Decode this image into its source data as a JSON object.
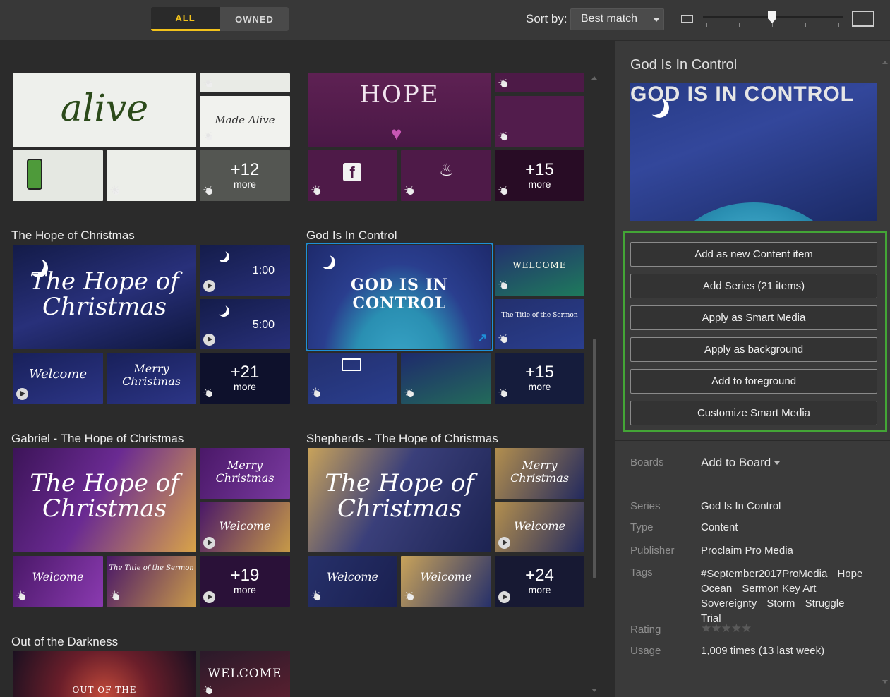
{
  "filters": {
    "all": "ALL",
    "owned": "OWNED"
  },
  "sort": {
    "label": "Sort by:",
    "value": "Best match"
  },
  "groups": {
    "alive": {
      "title": ""
    },
    "hope": {
      "title": ""
    },
    "hope_christmas": {
      "title": "The Hope of Christmas",
      "times": [
        "1:00",
        "5:00"
      ],
      "more": {
        "count": "+21",
        "word": "more"
      }
    },
    "god_control": {
      "title": "God Is In Control",
      "more": {
        "count": "+15",
        "word": "more"
      }
    },
    "gabriel": {
      "title": "Gabriel - The Hope of Christmas",
      "more": {
        "count": "+19",
        "word": "more"
      }
    },
    "shepherds": {
      "title": "Shepherds - The Hope of Christmas",
      "more": {
        "count": "+24",
        "word": "more"
      }
    },
    "darkness": {
      "title": "Out of the Darkness"
    }
  },
  "top_more": {
    "alive": {
      "count": "+12",
      "word": "more"
    },
    "hope": {
      "count": "+15",
      "word": "more"
    }
  },
  "panel": {
    "title": "God Is In Control",
    "actions": [
      "Add as new Content item",
      "Add Series (21 items)",
      "Apply as Smart Media",
      "Apply as background",
      "Add to foreground",
      "Customize Smart Media"
    ],
    "boards_label": "Boards",
    "add_board": "Add to Board",
    "meta": {
      "series_label": "Series",
      "series": "God Is In Control",
      "type_label": "Type",
      "type": "Content",
      "publisher_label": "Publisher",
      "publisher": "Proclaim Pro Media",
      "tags_label": "Tags",
      "tags": [
        "#September2017ProMedia",
        "Hope",
        "Ocean",
        "Sermon Key Art",
        "Sovereignty",
        "Storm",
        "Struggle",
        "Trial"
      ],
      "rating_label": "Rating",
      "rating": "★★★★★",
      "usage_label": "Usage",
      "usage": "1,009 times (13 last week)"
    }
  },
  "tile_text": {
    "alive": "alive",
    "made_alive": "Made Alive",
    "hope": "HOPE",
    "hope_of_christmas": "The Hope of Christmas",
    "welcome": "Welcome",
    "merry_christmas": "Merry Christmas",
    "god_is_in_control": "GOD IS IN CONTROL",
    "welcome_caps": "WELCOME",
    "title_of_sermon": "The Title of the Sermon",
    "out_of_the": "OUT OF THE"
  },
  "colors": {
    "accent": "#f2c21b",
    "selection": "#1e90d8",
    "action_border": "#43a536"
  }
}
